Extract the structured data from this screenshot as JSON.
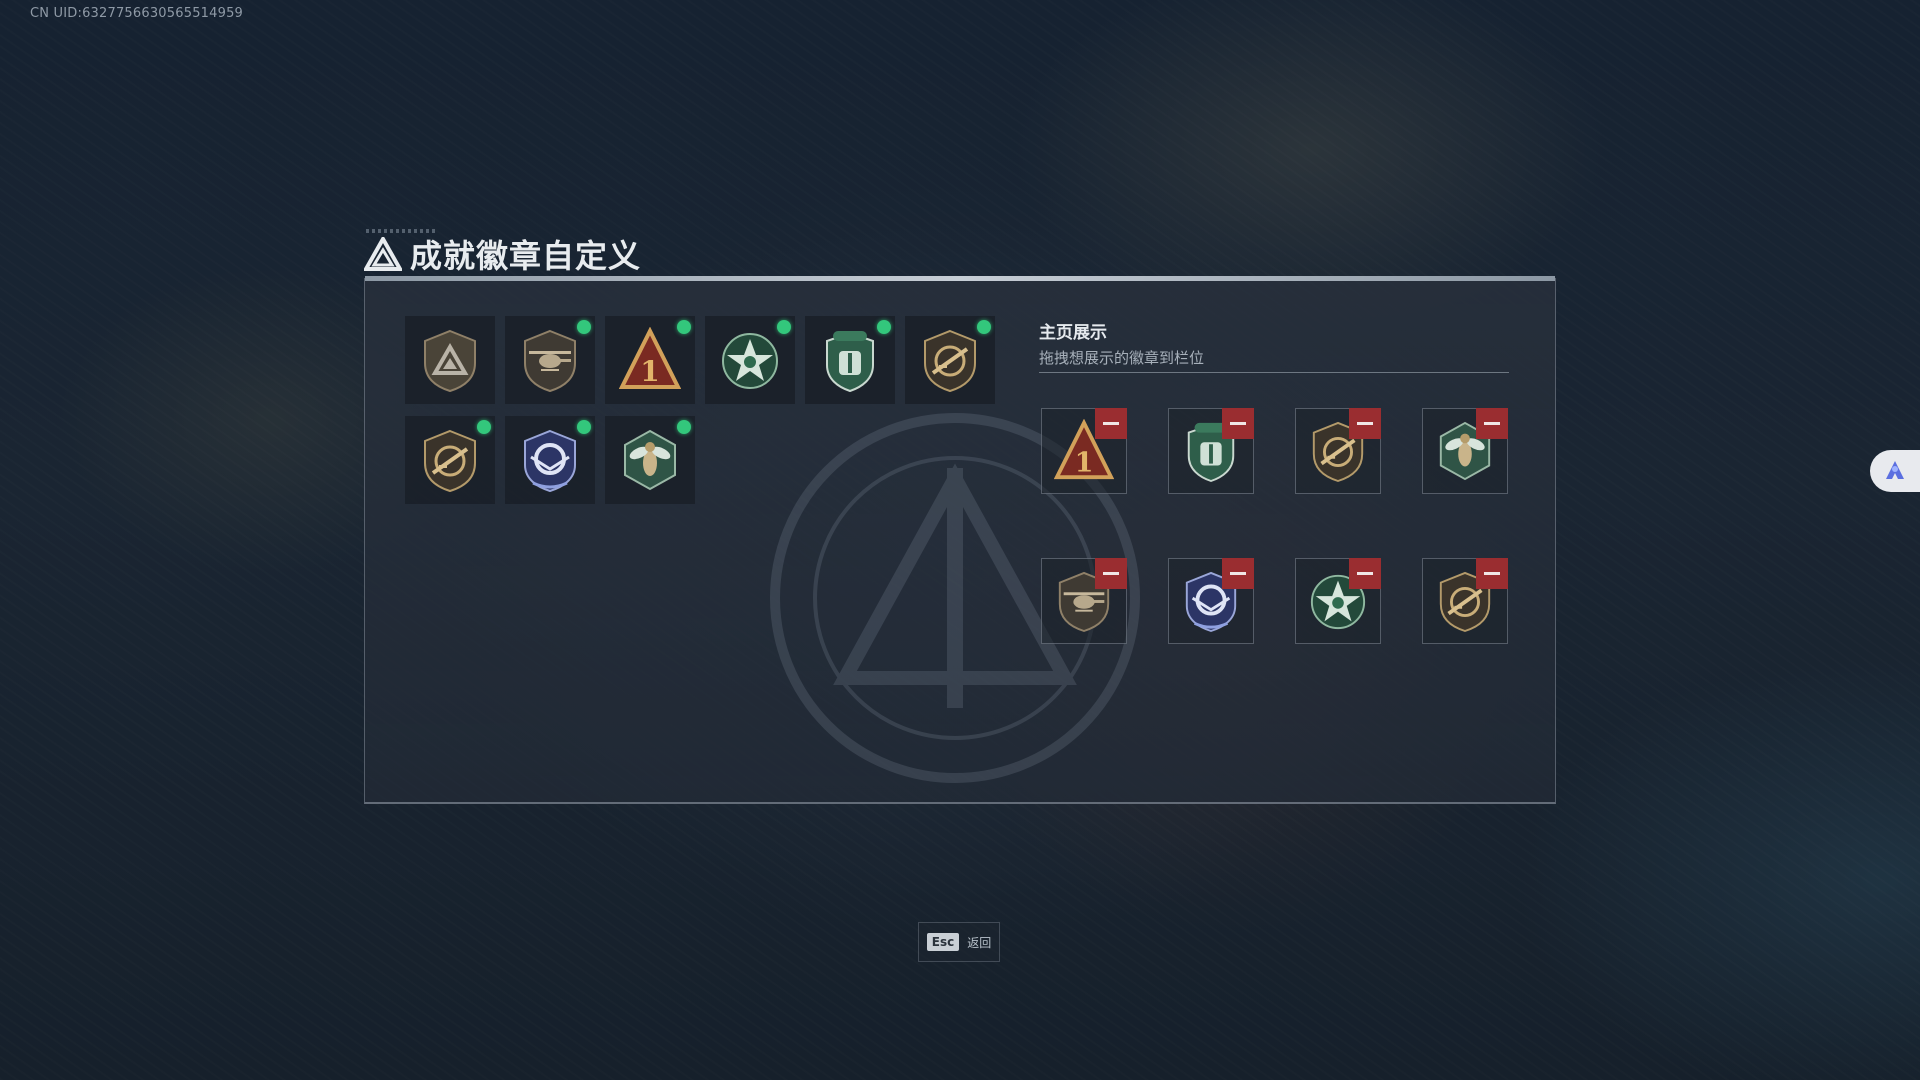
{
  "uid_text": "CN UID:6327756630565514959",
  "panel": {
    "title": "成就徽章自定义"
  },
  "inventory": [
    {
      "badge": "triangle-shield-badge",
      "new": false
    },
    {
      "badge": "helicopter-badge",
      "new": true
    },
    {
      "badge": "triangle-number-one-badge",
      "new": true
    },
    {
      "badge": "green-star-badge",
      "new": true
    },
    {
      "badge": "green-medic-shield-badge",
      "new": true
    },
    {
      "badge": "rifle-shield-badge",
      "new": true
    },
    {
      "badge": "rifle-shield-badge",
      "new": true
    },
    {
      "badge": "blue-wings-badge",
      "new": true
    },
    {
      "badge": "green-hex-wasp-badge",
      "new": true
    }
  ],
  "showcase": {
    "title": "主页展示",
    "subtitle": "拖拽想展示的徽章到栏位",
    "slots": [
      {
        "badge": "triangle-number-one-badge"
      },
      {
        "badge": "green-medic-shield-badge"
      },
      {
        "badge": "rifle-shield-badge"
      },
      {
        "badge": "green-hex-wasp-badge"
      },
      {
        "badge": "helicopter-badge"
      },
      {
        "badge": "blue-wings-badge"
      },
      {
        "badge": "green-star-badge"
      },
      {
        "badge": "rifle-shield-badge"
      }
    ]
  },
  "footer": {
    "esc_key": "Esc",
    "esc_label": "返回"
  },
  "colors": {
    "new_dot": "#33c77c",
    "remove_button": "#9a2d30",
    "accent_gold": "#c7a05c"
  }
}
